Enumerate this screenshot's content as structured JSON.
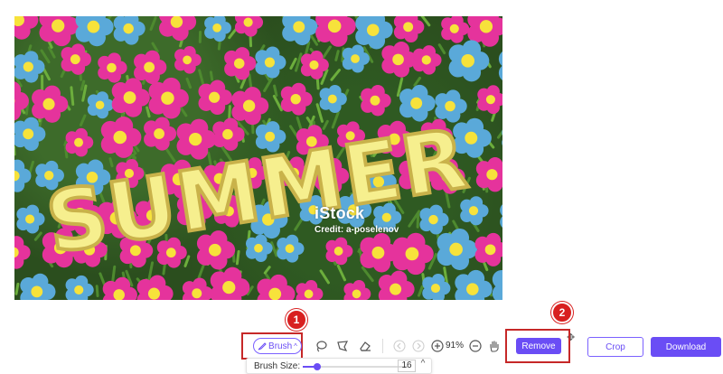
{
  "canvas": {
    "watermark_brand": "iStock",
    "watermark_credit": "Credit: a-poselenov",
    "headline": "SUMMER"
  },
  "toolbar": {
    "brush_label": "Brush",
    "tools": [
      "brush-icon",
      "lasso-icon",
      "polygon-lasso-icon",
      "eraser-icon",
      "undo-icon",
      "redo-icon",
      "zoom-in-icon",
      "zoom-out-icon",
      "hand-icon"
    ],
    "zoom_level": "91%",
    "remove_label": "Remove",
    "crop_label": "Crop",
    "download_label": "Download"
  },
  "brush_size": {
    "label": "Brush Size:",
    "value": "16",
    "slider_fraction": 0.14
  },
  "annotations": {
    "badge_1": "1",
    "badge_2": "2",
    "highlight_color": "#c62828"
  },
  "colors": {
    "accent": "#6a4df5",
    "flower_pink": "#e5339c",
    "flower_blue": "#5aa9d9",
    "flower_center": "#f7e23b",
    "letters": "#f6ef8e"
  }
}
